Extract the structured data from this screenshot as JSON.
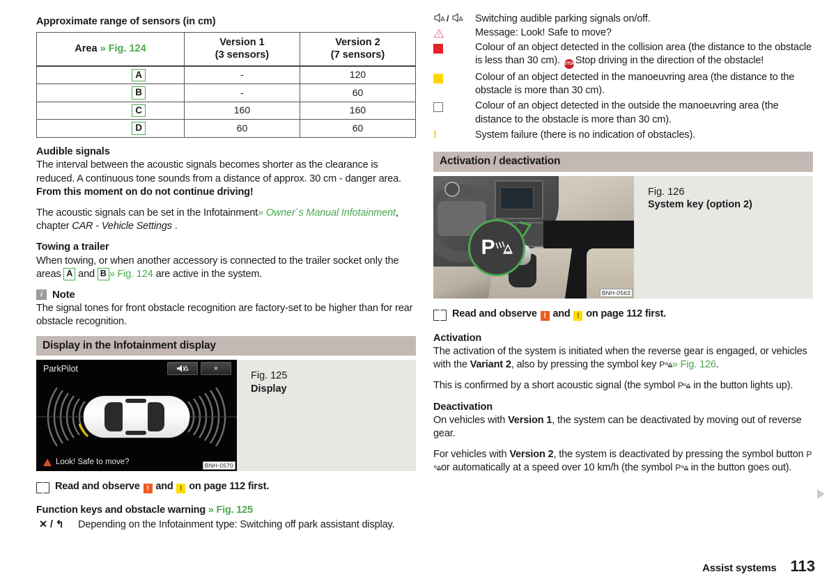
{
  "left": {
    "table_title": "Approximate range of sensors (in cm)",
    "table": {
      "headers": [
        {
          "main": "Area",
          "ref": "» Fig. 124",
          "sub": ""
        },
        {
          "main": "Version 1",
          "ref": "",
          "sub": "(3 sensors)"
        },
        {
          "main": "Version 2",
          "ref": "",
          "sub": "(7 sensors)"
        }
      ],
      "rows": [
        {
          "area": "A",
          "v1": "-",
          "v2": "120"
        },
        {
          "area": "B",
          "v1": "-",
          "v2": "60"
        },
        {
          "area": "C",
          "v1": "160",
          "v2": "160"
        },
        {
          "area": "D",
          "v1": "60",
          "v2": "60"
        }
      ]
    },
    "audible_heading": "Audible signals",
    "audible_p1_a": "The interval between the acoustic signals becomes shorter as the clearance is reduced. A continuous tone sounds from a distance of approx. 30 cm - danger area. ",
    "audible_p1_b": "From this moment on do not continue driving!",
    "audible_p2_a": "The acoustic signals can be set in the Infotainment",
    "audible_p2_ref": "» Owner´s Manual Infotainment",
    "audible_p2_b": ", chapter ",
    "audible_p2_c": "CAR - Vehicle Settings",
    "audible_p2_d": " .",
    "towing_heading": "Towing a trailer",
    "towing_p_a": "When towing, or when another accessory is connected to the trailer socket only the areas ",
    "towing_area_1": "A",
    "towing_p_b": " and ",
    "towing_area_2": "B",
    "towing_ref": "» Fig. 124",
    "towing_p_c": " are active in the system.",
    "note_title": "Note",
    "note_icon": "i",
    "note_body": "The signal tones for front obstacle recognition are factory-set to be higher than for rear obstacle recognition.",
    "section_display": "Display in the Infotainment display",
    "fig125": {
      "caption_line1": "Fig. 125",
      "caption_line2": "Display",
      "image_code": "BNH-0570",
      "screen_title": "ParkPilot",
      "screen_status": "Look! Safe to move?",
      "btn_mute": "mute-icon",
      "btn_close": "×"
    },
    "observe_a": "Read and observe ",
    "observe_b": " and ",
    "observe_c": " on page 112 first.",
    "fnkeys_head": "Function keys and obstacle warning ",
    "fnkeys_ref": "» Fig. 125",
    "fnkey_item": {
      "key": "✕ / ↰",
      "text": "Depending on the Infotainment type: Switching off park assistant display."
    }
  },
  "right": {
    "legend": [
      {
        "key": "speaker-pair",
        "key_text": "◁ᴀ / ◁ᴀ",
        "text": "Switching audible parking signals on/off."
      },
      {
        "key": "warning-triangle",
        "key_text": "",
        "text": "Message: Look! Safe to move?"
      },
      {
        "key": "red-square",
        "key_text": "",
        "text_a": "Colour of an object detected in the collision area (the distance to the obstacle is less than 30 cm). ",
        "text_b": "Stop driving in the direction of the obstacle!"
      },
      {
        "key": "yellow-square",
        "key_text": "",
        "text": "Colour of an object detected in the manoeuvring area (the distance to the obstacle is more than 30 cm)."
      },
      {
        "key": "white-square",
        "key_text": "",
        "text": "Colour of an object detected in the outside the manoeuvring area (the distance to the obstacle is more than 30 cm)."
      },
      {
        "key": "yellow-exclamation",
        "key_text": "!",
        "text": "System failure (there is no indication of obstacles)."
      }
    ],
    "section_activation": "Activation / deactivation",
    "fig126": {
      "caption_line1": "Fig. 126",
      "caption_line2": "System key (option 2)",
      "image_code": "BNH-0563",
      "callout_symbol": "P"
    },
    "observe_a": "Read and observe ",
    "observe_b": " and ",
    "observe_c": " on page 112 first.",
    "activation_heading": "Activation",
    "activation_p1_a": "The activation of the system is initiated when the reverse gear is engaged, or vehicles with the ",
    "activation_p1_b": "Variant 2",
    "activation_p1_c": ", also by pressing the symbol key ",
    "activation_p1_sym": "P",
    "activation_p1_ref": "» Fig. 126",
    "activation_p1_d": ".",
    "activation_p2_a": "This is confirmed by a short acoustic signal (the symbol ",
    "activation_p2_sym": "P",
    "activation_p2_b": " in the button lights up).",
    "deactivation_heading": "Deactivation",
    "deactivation_p1_a": "On vehicles with ",
    "deactivation_p1_b": "Version 1",
    "deactivation_p1_c": ", the system can be deactivated by moving out of reverse gear.",
    "deactivation_p2_a": "For vehicles with ",
    "deactivation_p2_b": "Version 2",
    "deactivation_p2_c": ", the system is deactivated by pressing the symbol button ",
    "deactivation_p2_sym": "P",
    "deactivation_p2_d": "or automatically at a speed over 10 km/h (the symbol ",
    "deactivation_p2_sym2": "P",
    "deactivation_p2_e": " in the button goes out)."
  },
  "footer": {
    "chapter": "Assist systems",
    "page": "113"
  },
  "colors": {
    "reference_green": "#4aa94f",
    "section_band": "#c3b8b3",
    "figure_bg": "#e9e7e4",
    "warn_red": "#ef5a20",
    "warn_yellow": "#ffdd00",
    "legend_red": "#e8202a",
    "legend_yellow": "#ffd800"
  }
}
